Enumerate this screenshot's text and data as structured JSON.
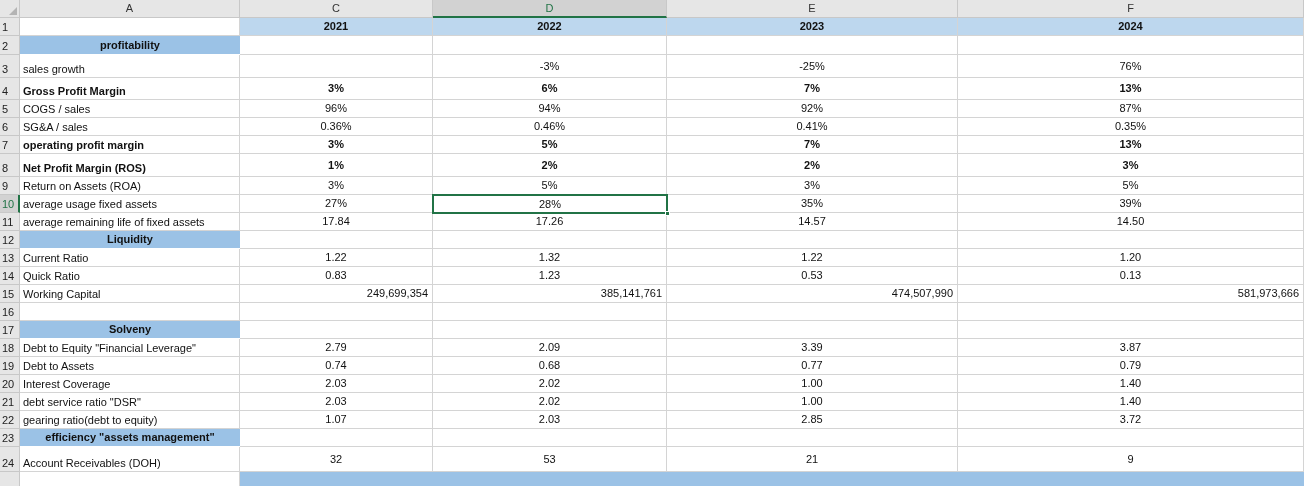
{
  "columns": [
    {
      "label": "A",
      "selected": false
    },
    {
      "label": "C",
      "selected": false
    },
    {
      "label": "D",
      "selected": true
    },
    {
      "label": "E",
      "selected": false
    },
    {
      "label": "F",
      "selected": false
    }
  ],
  "rows": [
    {
      "number": "1",
      "selected": false,
      "kind": "years",
      "cells": [
        {
          "text": "2021",
          "selected": false
        },
        {
          "text": "2022",
          "selected": false
        },
        {
          "text": "2023",
          "selected": false
        },
        {
          "text": "2024",
          "selected": false
        }
      ]
    },
    {
      "number": "2",
      "selected": false,
      "kind": "section",
      "label": "profitability"
    },
    {
      "number": "3",
      "selected": false,
      "kind": "metric",
      "bold": false,
      "label": "sales growth",
      "cells": [
        {
          "selected": false
        },
        {
          "text": "-3%",
          "selected": false
        },
        {
          "text": "-25%",
          "selected": false
        },
        {
          "text": "76%",
          "selected": false
        }
      ]
    },
    {
      "number": "4",
      "selected": false,
      "kind": "metric",
      "bold": true,
      "label": "Gross Profit Margin",
      "cells": [
        {
          "text": "3%",
          "selected": false
        },
        {
          "text": "6%",
          "selected": false
        },
        {
          "text": "7%",
          "selected": false
        },
        {
          "text": "13%",
          "selected": false
        }
      ]
    },
    {
      "number": "5",
      "selected": false,
      "kind": "metric",
      "bold": false,
      "label": "COGS / sales",
      "cells": [
        {
          "text": "96%",
          "selected": false
        },
        {
          "text": "94%",
          "selected": false
        },
        {
          "text": "92%",
          "selected": false
        },
        {
          "text": "87%",
          "selected": false
        }
      ]
    },
    {
      "number": "6",
      "selected": false,
      "kind": "metric",
      "bold": false,
      "label": "SG&A / sales",
      "cells": [
        {
          "text": "0.36%",
          "selected": false
        },
        {
          "text": "0.46%",
          "selected": false
        },
        {
          "text": "0.41%",
          "selected": false
        },
        {
          "text": "0.35%",
          "selected": false
        }
      ]
    },
    {
      "number": "7",
      "selected": false,
      "kind": "metric",
      "bold": true,
      "label": "operating profit margin",
      "cells": [
        {
          "text": "3%",
          "selected": false
        },
        {
          "text": "5%",
          "selected": false
        },
        {
          "text": "7%",
          "selected": false
        },
        {
          "text": "13%",
          "selected": false
        }
      ]
    },
    {
      "number": "8",
      "selected": false,
      "kind": "metric",
      "bold": true,
      "label": "Net Profit Margin (ROS)",
      "cells": [
        {
          "text": "1%",
          "selected": false
        },
        {
          "text": "2%",
          "selected": false
        },
        {
          "text": "2%",
          "selected": false
        },
        {
          "text": "3%",
          "selected": false
        }
      ]
    },
    {
      "number": "9",
      "selected": false,
      "kind": "metric",
      "bold": false,
      "label": "Return on Assets (ROA)",
      "cells": [
        {
          "text": "3%",
          "selected": false
        },
        {
          "text": "5%",
          "selected": false
        },
        {
          "text": "3%",
          "selected": false
        },
        {
          "text": "5%",
          "selected": false
        }
      ]
    },
    {
      "number": "10",
      "selected": true,
      "kind": "metric",
      "bold": false,
      "label": "average usage fixed assets",
      "cells": [
        {
          "text": "27%",
          "selected": false
        },
        {
          "text": "28%",
          "selected": true
        },
        {
          "text": "35%",
          "selected": false
        },
        {
          "text": "39%",
          "selected": false
        }
      ]
    },
    {
      "number": "11",
      "selected": false,
      "kind": "metric",
      "bold": false,
      "label": "average remaining life of fixed assets",
      "cells": [
        {
          "text": "17.84",
          "selected": false
        },
        {
          "text": "17.26",
          "selected": false
        },
        {
          "text": "14.57",
          "selected": false
        },
        {
          "text": "14.50",
          "selected": false
        }
      ]
    },
    {
      "number": "12",
      "selected": false,
      "kind": "section",
      "label": "Liquidity"
    },
    {
      "number": "13",
      "selected": false,
      "kind": "metric",
      "bold": false,
      "label": "Current Ratio",
      "cells": [
        {
          "text": "1.22",
          "selected": false
        },
        {
          "text": "1.32",
          "selected": false
        },
        {
          "text": "1.22",
          "selected": false
        },
        {
          "text": "1.20",
          "selected": false
        }
      ]
    },
    {
      "number": "14",
      "selected": false,
      "kind": "metric",
      "bold": false,
      "label": "Quick Ratio",
      "cells": [
        {
          "text": "0.83",
          "selected": false
        },
        {
          "text": "1.23",
          "selected": false
        },
        {
          "text": "0.53",
          "selected": false
        },
        {
          "text": "0.13",
          "selected": false
        }
      ]
    },
    {
      "number": "15",
      "selected": false,
      "kind": "amount",
      "bold": false,
      "label": "Working Capital",
      "cells": [
        {
          "text": "249,699,354",
          "selected": false
        },
        {
          "text": "385,141,761",
          "selected": false
        },
        {
          "text": "474,507,990",
          "selected": false
        },
        {
          "text": "581,973,666",
          "selected": false
        }
      ]
    },
    {
      "number": "16",
      "selected": false,
      "kind": "blank"
    },
    {
      "number": "17",
      "selected": false,
      "kind": "section",
      "label": "Solveny"
    },
    {
      "number": "18",
      "selected": false,
      "kind": "metric",
      "bold": false,
      "label": "Debt to Equity \"Financial Leverage\"",
      "cells": [
        {
          "text": "2.79",
          "selected": false
        },
        {
          "text": "2.09",
          "selected": false
        },
        {
          "text": "3.39",
          "selected": false
        },
        {
          "text": "3.87",
          "selected": false
        }
      ]
    },
    {
      "number": "19",
      "selected": false,
      "kind": "metric",
      "bold": false,
      "label": "Debt to Assets",
      "cells": [
        {
          "text": "0.74",
          "selected": false
        },
        {
          "text": "0.68",
          "selected": false
        },
        {
          "text": "0.77",
          "selected": false
        },
        {
          "text": "0.79",
          "selected": false
        }
      ]
    },
    {
      "number": "20",
      "selected": false,
      "kind": "metric",
      "bold": false,
      "label": "Interest Coverage",
      "cells": [
        {
          "text": "2.03",
          "selected": false
        },
        {
          "text": "2.02",
          "selected": false
        },
        {
          "text": "1.00",
          "selected": false
        },
        {
          "text": "1.40",
          "selected": false
        }
      ]
    },
    {
      "number": "21",
      "selected": false,
      "kind": "metric",
      "bold": false,
      "label": "debt service ratio \"DSR\"",
      "cells": [
        {
          "text": "2.03",
          "selected": false
        },
        {
          "text": "2.02",
          "selected": false
        },
        {
          "text": "1.00",
          "selected": false
        },
        {
          "text": "1.40",
          "selected": false
        }
      ]
    },
    {
      "number": "22",
      "selected": false,
      "kind": "metric",
      "bold": false,
      "label": "gearing ratio(debt to equity)",
      "cells": [
        {
          "text": "1.07",
          "selected": false
        },
        {
          "text": "2.03",
          "selected": false
        },
        {
          "text": "2.85",
          "selected": false
        },
        {
          "text": "3.72",
          "selected": false
        }
      ]
    },
    {
      "number": "23",
      "selected": false,
      "kind": "section",
      "label": "efficiency \"assets management\""
    },
    {
      "number": "24",
      "selected": false,
      "kind": "metric",
      "bold": false,
      "label": "Account Receivables (DOH)",
      "cells": [
        {
          "text": "32",
          "selected": false
        },
        {
          "text": "53",
          "selected": false
        },
        {
          "text": "21",
          "selected": false
        },
        {
          "text": "9",
          "selected": false
        }
      ]
    },
    {
      "kind": "cut"
    }
  ]
}
